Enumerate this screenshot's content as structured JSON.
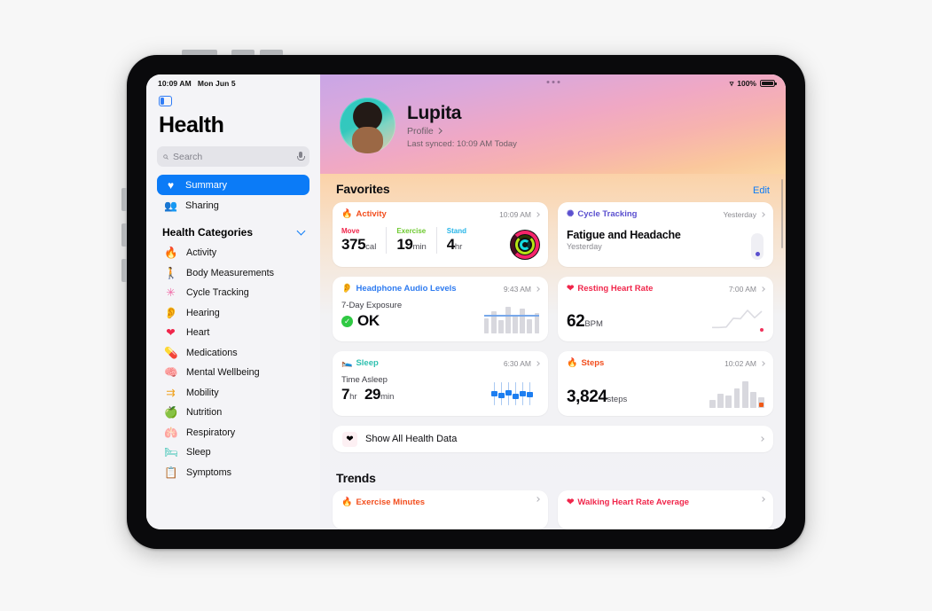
{
  "statusbar": {
    "time": "10:09 AM",
    "date": "Mon Jun 5",
    "wifi_icon": "wifi-icon",
    "battery_percent": "100%"
  },
  "sidebar": {
    "app_title": "Health",
    "search": {
      "placeholder": "Search",
      "value": "",
      "mic_icon": "microphone-icon"
    },
    "nav": [
      {
        "label": "Summary",
        "icon": "heart-icon",
        "selected": true
      },
      {
        "label": "Sharing",
        "icon": "people-icon",
        "selected": false
      }
    ],
    "section": {
      "title": "Health Categories",
      "chevron": "chevron-down-icon"
    },
    "categories": [
      {
        "label": "Activity",
        "icon": "flame-icon",
        "color": "#f24e1e"
      },
      {
        "label": "Body Measurements",
        "icon": "figure-icon",
        "color": "#9b59e0"
      },
      {
        "label": "Cycle Tracking",
        "icon": "cycle-icon",
        "color": "#f06ca8"
      },
      {
        "label": "Hearing",
        "icon": "ear-icon",
        "color": "#3d8df5"
      },
      {
        "label": "Heart",
        "icon": "heart-icon",
        "color": "#f0264b"
      },
      {
        "label": "Medications",
        "icon": "pills-icon",
        "color": "#2e7bf0"
      },
      {
        "label": "Mental Wellbeing",
        "icon": "head-icon",
        "color": "#2fc0a8"
      },
      {
        "label": "Mobility",
        "icon": "arrows-icon",
        "color": "#f0a21e"
      },
      {
        "label": "Nutrition",
        "icon": "apple-icon",
        "color": "#4cbd5a"
      },
      {
        "label": "Respiratory",
        "icon": "lungs-icon",
        "color": "#3d9bf5"
      },
      {
        "label": "Sleep",
        "icon": "bed-icon",
        "color": "#2fc0b0"
      },
      {
        "label": "Symptoms",
        "icon": "clipboard-icon",
        "color": "#8a8a92"
      }
    ]
  },
  "profile": {
    "name": "Lupita",
    "profile_link": "Profile",
    "last_synced": "Last synced: 10:09 AM Today",
    "avatar": "user-avatar"
  },
  "favorites": {
    "title": "Favorites",
    "edit_label": "Edit",
    "cards": {
      "activity": {
        "category": "Activity",
        "icon": "flame-icon",
        "color": "#f24e1e",
        "time": "10:09 AM",
        "metrics": [
          {
            "label": "Move",
            "value": "375",
            "unit": "cal",
            "color": "#f0264b"
          },
          {
            "label": "Exercise",
            "value": "19",
            "unit": "min",
            "color": "#6dc92f"
          },
          {
            "label": "Stand",
            "value": "4",
            "unit": "hr",
            "color": "#26b5e8"
          }
        ],
        "rings_icon": "activity-rings-icon"
      },
      "cycle": {
        "category": "Cycle Tracking",
        "icon": "cycle-icon",
        "color": "#5a4fcf",
        "time": "Yesterday",
        "headline": "Fatigue and Headache",
        "subtext": "Yesterday"
      },
      "headphone": {
        "category": "Headphone Audio Levels",
        "icon": "ear-icon",
        "color": "#2e7bf0",
        "time": "9:43 AM",
        "label": "7-Day Exposure",
        "status": "OK",
        "status_icon": "check-circle-icon"
      },
      "resting_hr": {
        "category": "Resting Heart Rate",
        "icon": "heart-icon",
        "color": "#f0264b",
        "time": "7:00 AM",
        "value": "62",
        "unit": "BPM"
      },
      "sleep": {
        "category": "Sleep",
        "icon": "bed-icon",
        "color": "#2fc0b0",
        "time": "6:30 AM",
        "label": "Time Asleep",
        "hours": "7",
        "hours_unit": "hr",
        "minutes": "29",
        "minutes_unit": "min"
      },
      "steps": {
        "category": "Steps",
        "icon": "flame-icon",
        "color": "#f24e1e",
        "time": "10:02 AM",
        "value": "3,824",
        "unit": "steps"
      }
    }
  },
  "show_all": {
    "label": "Show All Health Data",
    "icon": "heart-icon"
  },
  "trends": {
    "title": "Trends",
    "cards": [
      {
        "label": "Exercise Minutes",
        "icon": "flame-icon",
        "color": "#f24e1e"
      },
      {
        "label": "Walking Heart Rate Average",
        "icon": "heart-icon",
        "color": "#f0264b"
      }
    ]
  },
  "chart_data": [
    {
      "type": "bar",
      "title": "Headphone Audio Levels 7-Day Exposure",
      "categories": [
        "1",
        "2",
        "3",
        "4",
        "5",
        "6",
        "7",
        "8"
      ],
      "values": [
        55,
        80,
        48,
        95,
        62,
        88,
        50,
        72
      ],
      "threshold": 60,
      "threshold_color": "#78a8ea",
      "bar_color": "#d8d8de"
    },
    {
      "type": "line",
      "title": "Resting Heart Rate",
      "x": [
        0,
        1,
        2,
        3,
        4,
        5,
        6,
        7
      ],
      "values": [
        18,
        18,
        20,
        58,
        56,
        92,
        60,
        88
      ],
      "end_marker_color": "#f0325b",
      "line_color": "#dcdce2"
    },
    {
      "type": "bar",
      "title": "Sleep Stages",
      "categories": [
        "1",
        "2",
        "3",
        "4",
        "5",
        "6"
      ],
      "values": [
        12,
        12,
        12,
        12,
        12,
        12
      ],
      "bar_color": "#1d7ef0"
    },
    {
      "type": "bar",
      "title": "Steps",
      "categories": [
        "1",
        "2",
        "3",
        "4",
        "5",
        "6",
        "7"
      ],
      "values": [
        30,
        52,
        44,
        72,
        96,
        58,
        40
      ],
      "bar_color": "#d8d8de",
      "end_marker_color": "#f05a18"
    }
  ]
}
